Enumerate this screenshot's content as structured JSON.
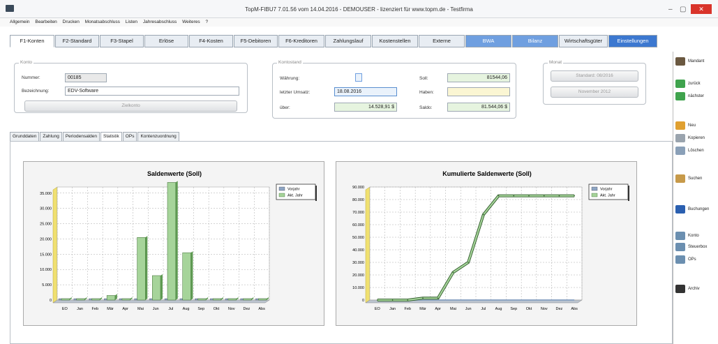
{
  "window": {
    "title": "TopM-FIBU7 7.01.56 vom 14.04.2016 - DEMOUSER - lizenziert für www.topm.de - Testfirma",
    "minimize": "–",
    "maximize": "▢",
    "close": "✕"
  },
  "menu": [
    "Allgemein",
    "Bearbeiten",
    "Drucken",
    "Monatsabschluss",
    "Listen",
    "Jahresabschluss",
    "Weiteres",
    "?"
  ],
  "tabs": [
    {
      "label": "F1-Konten",
      "style": "active"
    },
    {
      "label": "F2-Standard",
      "style": ""
    },
    {
      "label": "F3-Stapel",
      "style": ""
    },
    {
      "label": "Erlöse",
      "style": ""
    },
    {
      "label": "F4-Kosten",
      "style": ""
    },
    {
      "label": "F5-Debitoren",
      "style": ""
    },
    {
      "label": "F6-Kreditoren",
      "style": ""
    },
    {
      "label": "Zahlungslauf",
      "style": ""
    },
    {
      "label": "Kostenstellen",
      "style": ""
    },
    {
      "label": "Externe",
      "style": ""
    },
    {
      "label": "BWA",
      "style": "blue"
    },
    {
      "label": "Bilanz",
      "style": "blue"
    },
    {
      "label": "Wirtschaftsgüter",
      "style": ""
    },
    {
      "label": "Einstellungen",
      "style": "darkblue"
    }
  ],
  "konto": {
    "group": "Konto",
    "nummer_label": "Nummer:",
    "nummer_value": "00185",
    "bezeichnung_label": "Bezeichnung:",
    "bezeichnung_value": "EDV-Software",
    "button": "Zielkonto"
  },
  "kontostand": {
    "group": "Kontostand",
    "waehrung_label": "Währung:",
    "letzter_label": "letzter Umsatz:",
    "letzter_value": "18.08.2016",
    "ueber_label": "über:",
    "ueber_value": "14.528,91 $",
    "soll_label": "Soll:",
    "soll_value": "81544,06",
    "haben_label": "Haben:",
    "haben_value": "",
    "saldo_label": "Saldo:",
    "saldo_value": "81.544,06 $"
  },
  "monat": {
    "group": "Monat",
    "btn1": "Standard: 08/2016",
    "btn2": "November 2012"
  },
  "subtabs": [
    "Grunddaten",
    "Zahlung",
    "Periodensalden",
    "Statistik",
    "OPs",
    "Kontenzuordnung"
  ],
  "sidebar": [
    {
      "label": "Mandant",
      "icon": "mandant-icon",
      "color": "#6a5840"
    },
    {
      "label": "zurück",
      "icon": "arrow-left-icon",
      "color": "#3fa34d"
    },
    {
      "label": "nächster",
      "icon": "arrow-right-icon",
      "color": "#3fa34d"
    },
    {
      "label": "Neu",
      "icon": "new-icon",
      "color": "#e0a030"
    },
    {
      "label": "Kopieren",
      "icon": "copy-icon",
      "color": "#9aa4ae"
    },
    {
      "label": "Löschen",
      "icon": "delete-icon",
      "color": "#8aa0b8"
    },
    {
      "label": "Suchen",
      "icon": "search-icon",
      "color": "#c79a4a"
    },
    {
      "label": "Buchungen",
      "icon": "book-icon",
      "color": "#2a5fb0"
    },
    {
      "label": "Konto",
      "icon": "account-icon",
      "color": "#6b8fb0"
    },
    {
      "label": "Steuerbox",
      "icon": "tax-icon",
      "color": "#6b8fb0"
    },
    {
      "label": "OPs",
      "icon": "ops-icon",
      "color": "#6b8fb0"
    },
    {
      "label": "Archiv",
      "icon": "archive-icon",
      "color": "#333"
    }
  ],
  "chart_data": [
    {
      "type": "bar",
      "title": "Saldenwerte (Soll)",
      "categories": [
        "EO",
        "Jan",
        "Feb",
        "Mär",
        "Apr",
        "Mai",
        "Jun",
        "Jul",
        "Aug",
        "Sep",
        "Okt",
        "Nov",
        "Dez",
        "Abs"
      ],
      "ylim": [
        0,
        37000
      ],
      "yticks": [
        "0",
        "5.000",
        "10.000",
        "15.000",
        "20.000",
        "25.000",
        "30.000",
        "35.000"
      ],
      "series": [
        {
          "name": "Vorjahr",
          "color": "#8ea6c4",
          "values": [
            0,
            0,
            0,
            0,
            0,
            0,
            0,
            0,
            0,
            0,
            0,
            0,
            0,
            0
          ]
        },
        {
          "name": "Akt. Jahr",
          "color": "#a6d49a",
          "values": [
            0,
            0,
            0,
            1500,
            0,
            20500,
            8000,
            38500,
            15500,
            0,
            0,
            0,
            0,
            0
          ]
        }
      ]
    },
    {
      "type": "area",
      "title": "Kumulierte Saldenwerte (Soll)",
      "categories": [
        "EO",
        "Jan",
        "Feb",
        "Mär",
        "Apr",
        "Mai",
        "Jun",
        "Jul",
        "Aug",
        "Sep",
        "Okt",
        "Nov",
        "Dez",
        "Abs"
      ],
      "ylim": [
        0,
        90000
      ],
      "yticks": [
        "0",
        "10.000",
        "20.000",
        "30.000",
        "40.000",
        "50.000",
        "60.000",
        "70.000",
        "80.000",
        "90.000"
      ],
      "series": [
        {
          "name": "Vorjahr",
          "color": "#8ea6c4",
          "values": [
            0,
            0,
            0,
            0,
            0,
            0,
            0,
            0,
            0,
            0,
            0,
            0,
            0,
            0
          ]
        },
        {
          "name": "Akt. Jahr",
          "color": "#a6d49a",
          "values": [
            0,
            0,
            0,
            1500,
            1500,
            22000,
            30000,
            68000,
            83000,
            83000,
            83000,
            83000,
            83000,
            83000
          ]
        }
      ]
    }
  ]
}
